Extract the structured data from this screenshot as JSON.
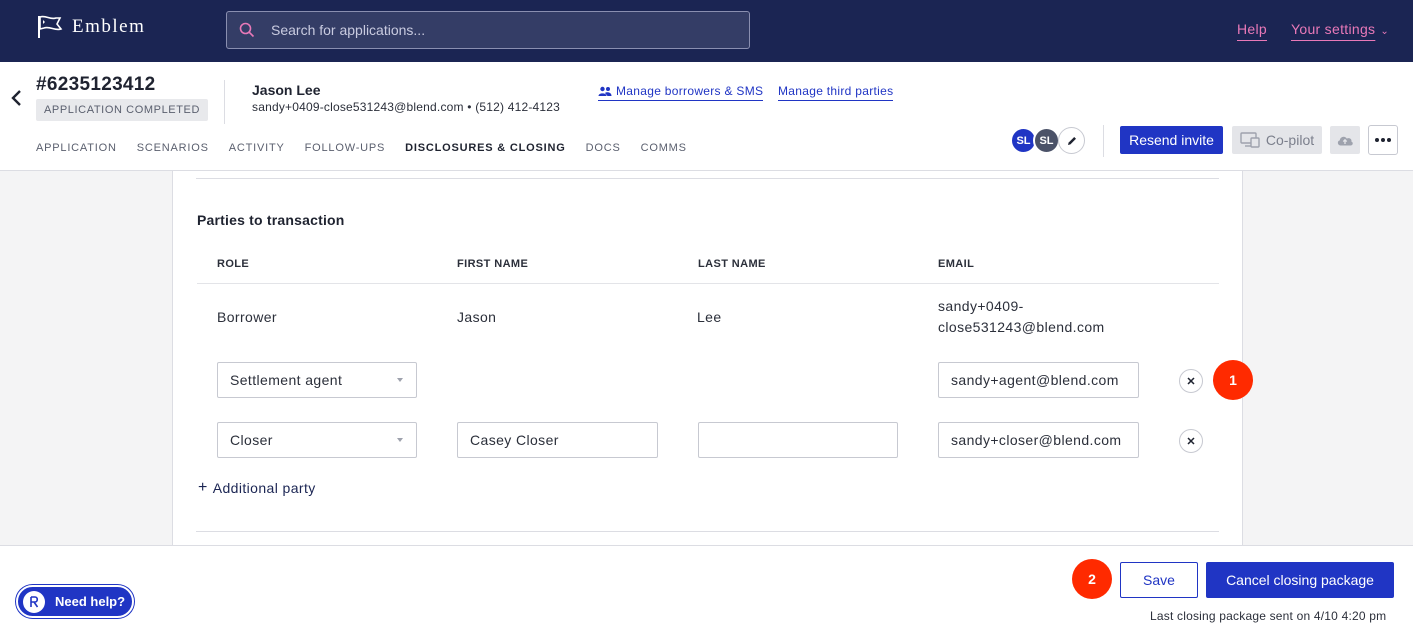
{
  "nav": {
    "brand": "Emblem",
    "search_placeholder": "Search for applications...",
    "help": "Help",
    "settings": "Your settings",
    "colors": {
      "bg": "#1b2553",
      "link": "#e979b8"
    }
  },
  "header": {
    "app_number": "#6235123412",
    "status": "APPLICATION COMPLETED",
    "borrower_name": "Jason Lee",
    "borrower_contact": "sandy+0409-close531243@blend.com • (512) 412-4123",
    "manage_borrowers": "Manage borrowers & SMS",
    "manage_third": "Manage third parties",
    "tabs": [
      {
        "label": "APPLICATION"
      },
      {
        "label": "SCENARIOS"
      },
      {
        "label": "ACTIVITY"
      },
      {
        "label": "FOLLOW-UPS"
      },
      {
        "label": "DISCLOSURES & CLOSING"
      },
      {
        "label": "DOCS"
      },
      {
        "label": "COMMS"
      }
    ],
    "active_tab": "DISCLOSURES & CLOSING",
    "avatars": [
      "SL",
      "SL"
    ],
    "resend": "Resend invite",
    "copilot": "Co-pilot",
    "accent": "#2035c4"
  },
  "parties": {
    "title": "Parties to transaction",
    "columns": [
      "ROLE",
      "FIRST NAME",
      "LAST NAME",
      "EMAIL"
    ],
    "borrower_row": {
      "role": "Borrower",
      "first": "Jason",
      "last": "Lee",
      "email_line1": "sandy+0409-",
      "email_line2": "close531243@blend.com"
    },
    "editable_rows": [
      {
        "role": "Settlement agent",
        "first": "",
        "last": "",
        "email": "sandy+agent@blend.com"
      },
      {
        "role": "Closer",
        "first": "Casey Closer",
        "last": "",
        "email": "sandy+closer@blend.com"
      }
    ],
    "add_party": "Additional party"
  },
  "markers": [
    "1",
    "2"
  ],
  "footer": {
    "need_help": "Need help?",
    "save": "Save",
    "cancel_package": "Cancel closing package",
    "last_sent": "Last closing package sent on 4/10 4:20 pm"
  }
}
